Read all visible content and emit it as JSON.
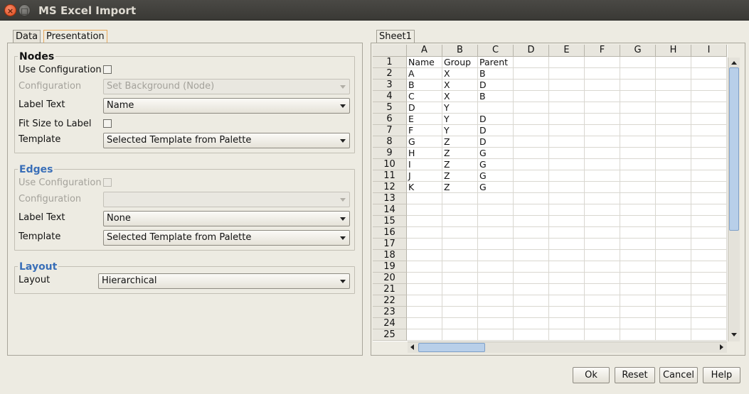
{
  "window": {
    "title": "MS Excel Import"
  },
  "left_tabs": [
    {
      "label": "Data",
      "active": false
    },
    {
      "label": "Presentation",
      "active": true
    }
  ],
  "nodes": {
    "title": "Nodes",
    "use_configuration_label": "Use Configuration",
    "configuration_label": "Configuration",
    "configuration_value": "Set Background (Node)",
    "label_text_label": "Label Text",
    "label_text_value": "Name",
    "fit_size_label": "Fit Size to Label",
    "template_label": "Template",
    "template_value": "Selected Template from Palette"
  },
  "edges": {
    "title": "Edges",
    "use_configuration_label": "Use Configuration",
    "configuration_label": "Configuration",
    "configuration_value": "",
    "label_text_label": "Label Text",
    "label_text_value": "None",
    "template_label": "Template",
    "template_value": "Selected Template from Palette"
  },
  "layout": {
    "title": "Layout",
    "layout_label": "Layout",
    "layout_value": "Hierarchical"
  },
  "sheet_tab": {
    "label": "Sheet1"
  },
  "spreadsheet": {
    "columns": [
      "A",
      "B",
      "C",
      "D",
      "E",
      "F",
      "G",
      "H",
      "I"
    ],
    "row_numbers": [
      "1",
      "2",
      "3",
      "4",
      "5",
      "6",
      "7",
      "8",
      "9",
      "10",
      "11",
      "12",
      "13",
      "14",
      "15",
      "16",
      "17",
      "18",
      "19",
      "20",
      "21",
      "22",
      "23",
      "24",
      "25"
    ],
    "rows": [
      [
        "Name",
        "Group",
        "Parent"
      ],
      [
        "A",
        "X",
        "B"
      ],
      [
        "B",
        "X",
        "D"
      ],
      [
        "C",
        "X",
        "B"
      ],
      [
        "D",
        "Y",
        ""
      ],
      [
        "E",
        "Y",
        "D"
      ],
      [
        "F",
        "Y",
        "D"
      ],
      [
        "G",
        "Z",
        "D"
      ],
      [
        "H",
        "Z",
        "G"
      ],
      [
        "I",
        "Z",
        "G"
      ],
      [
        "J",
        "Z",
        "G"
      ],
      [
        "K",
        "Z",
        "G"
      ]
    ]
  },
  "buttons": {
    "ok": "Ok",
    "reset": "Reset",
    "cancel": "Cancel",
    "help": "Help"
  }
}
